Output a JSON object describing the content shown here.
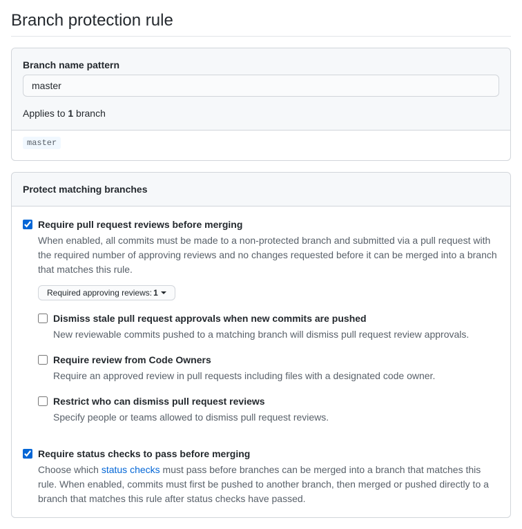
{
  "page": {
    "title": "Branch protection rule"
  },
  "pattern_section": {
    "label": "Branch name pattern",
    "value": "master",
    "applies_prefix": "Applies to ",
    "applies_count": "1",
    "applies_suffix": " branch",
    "matched_branch": "master"
  },
  "protect_header": "Protect matching branches",
  "req_reviews": {
    "title": "Require pull request reviews before merging",
    "desc": "When enabled, all commits must be made to a non-protected branch and submitted via a pull request with the required number of approving reviews and no changes requested before it can be merged into a branch that matches this rule.",
    "dropdown_label": "Required approving reviews: ",
    "dropdown_value": "1"
  },
  "dismiss_stale": {
    "title": "Dismiss stale pull request approvals when new commits are pushed",
    "desc": "New reviewable commits pushed to a matching branch will dismiss pull request review approvals."
  },
  "code_owners": {
    "title": "Require review from Code Owners",
    "desc": "Require an approved review in pull requests including files with a designated code owner."
  },
  "restrict_dismiss": {
    "title": "Restrict who can dismiss pull request reviews",
    "desc": "Specify people or teams allowed to dismiss pull request reviews."
  },
  "status_checks": {
    "title": "Require status checks to pass before merging",
    "desc_prefix": "Choose which ",
    "desc_link": "status checks",
    "desc_suffix": " must pass before branches can be merged into a branch that matches this rule. When enabled, commits must first be pushed to another branch, then merged or pushed directly to a branch that matches this rule after status checks have passed."
  }
}
